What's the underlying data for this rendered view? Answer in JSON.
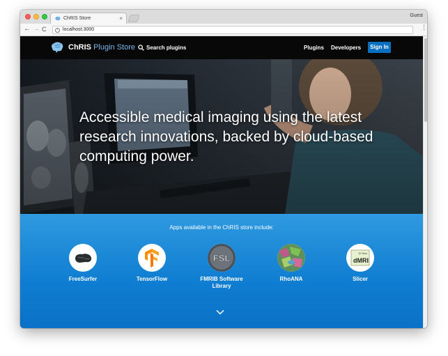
{
  "browser": {
    "tab_title": "ChRIS Store",
    "tab_close": "×",
    "profile_label": "Guest",
    "url": "localhost:3000",
    "back_icon": "←",
    "forward_icon": "→",
    "reload_icon": "C",
    "menu_icon": "⋮",
    "info_icon": "i"
  },
  "nav": {
    "brand_bold": "ChRIS",
    "brand_rest": "Plugin Store",
    "search_label": "Search plugins",
    "links": [
      "Plugins",
      "Developers"
    ],
    "signin_label": "Sign In"
  },
  "hero": {
    "headline": "Accessible medical imaging using the latest research innovations, backed by cloud-based computing power."
  },
  "apps": {
    "heading": "Apps available in the ChRIS store include:",
    "items": [
      {
        "name": "FreeSurfer",
        "icon": "freesurfer-brain-icon"
      },
      {
        "name": "TensorFlow",
        "icon": "tensorflow-logo-icon"
      },
      {
        "name": "FMRIB Software Library",
        "icon": "fsl-logo-icon"
      },
      {
        "name": "RhoANA",
        "icon": "rhoana-neuron-icon"
      },
      {
        "name": "Slicer",
        "icon": "dmri-slicer-icon",
        "icon_text": "dMRI",
        "icon_subtext": "3D Slicer"
      }
    ]
  },
  "colors": {
    "accent": "#0b6fc0",
    "nav_bg": "#080808",
    "apps_bg": "#1487d8"
  }
}
